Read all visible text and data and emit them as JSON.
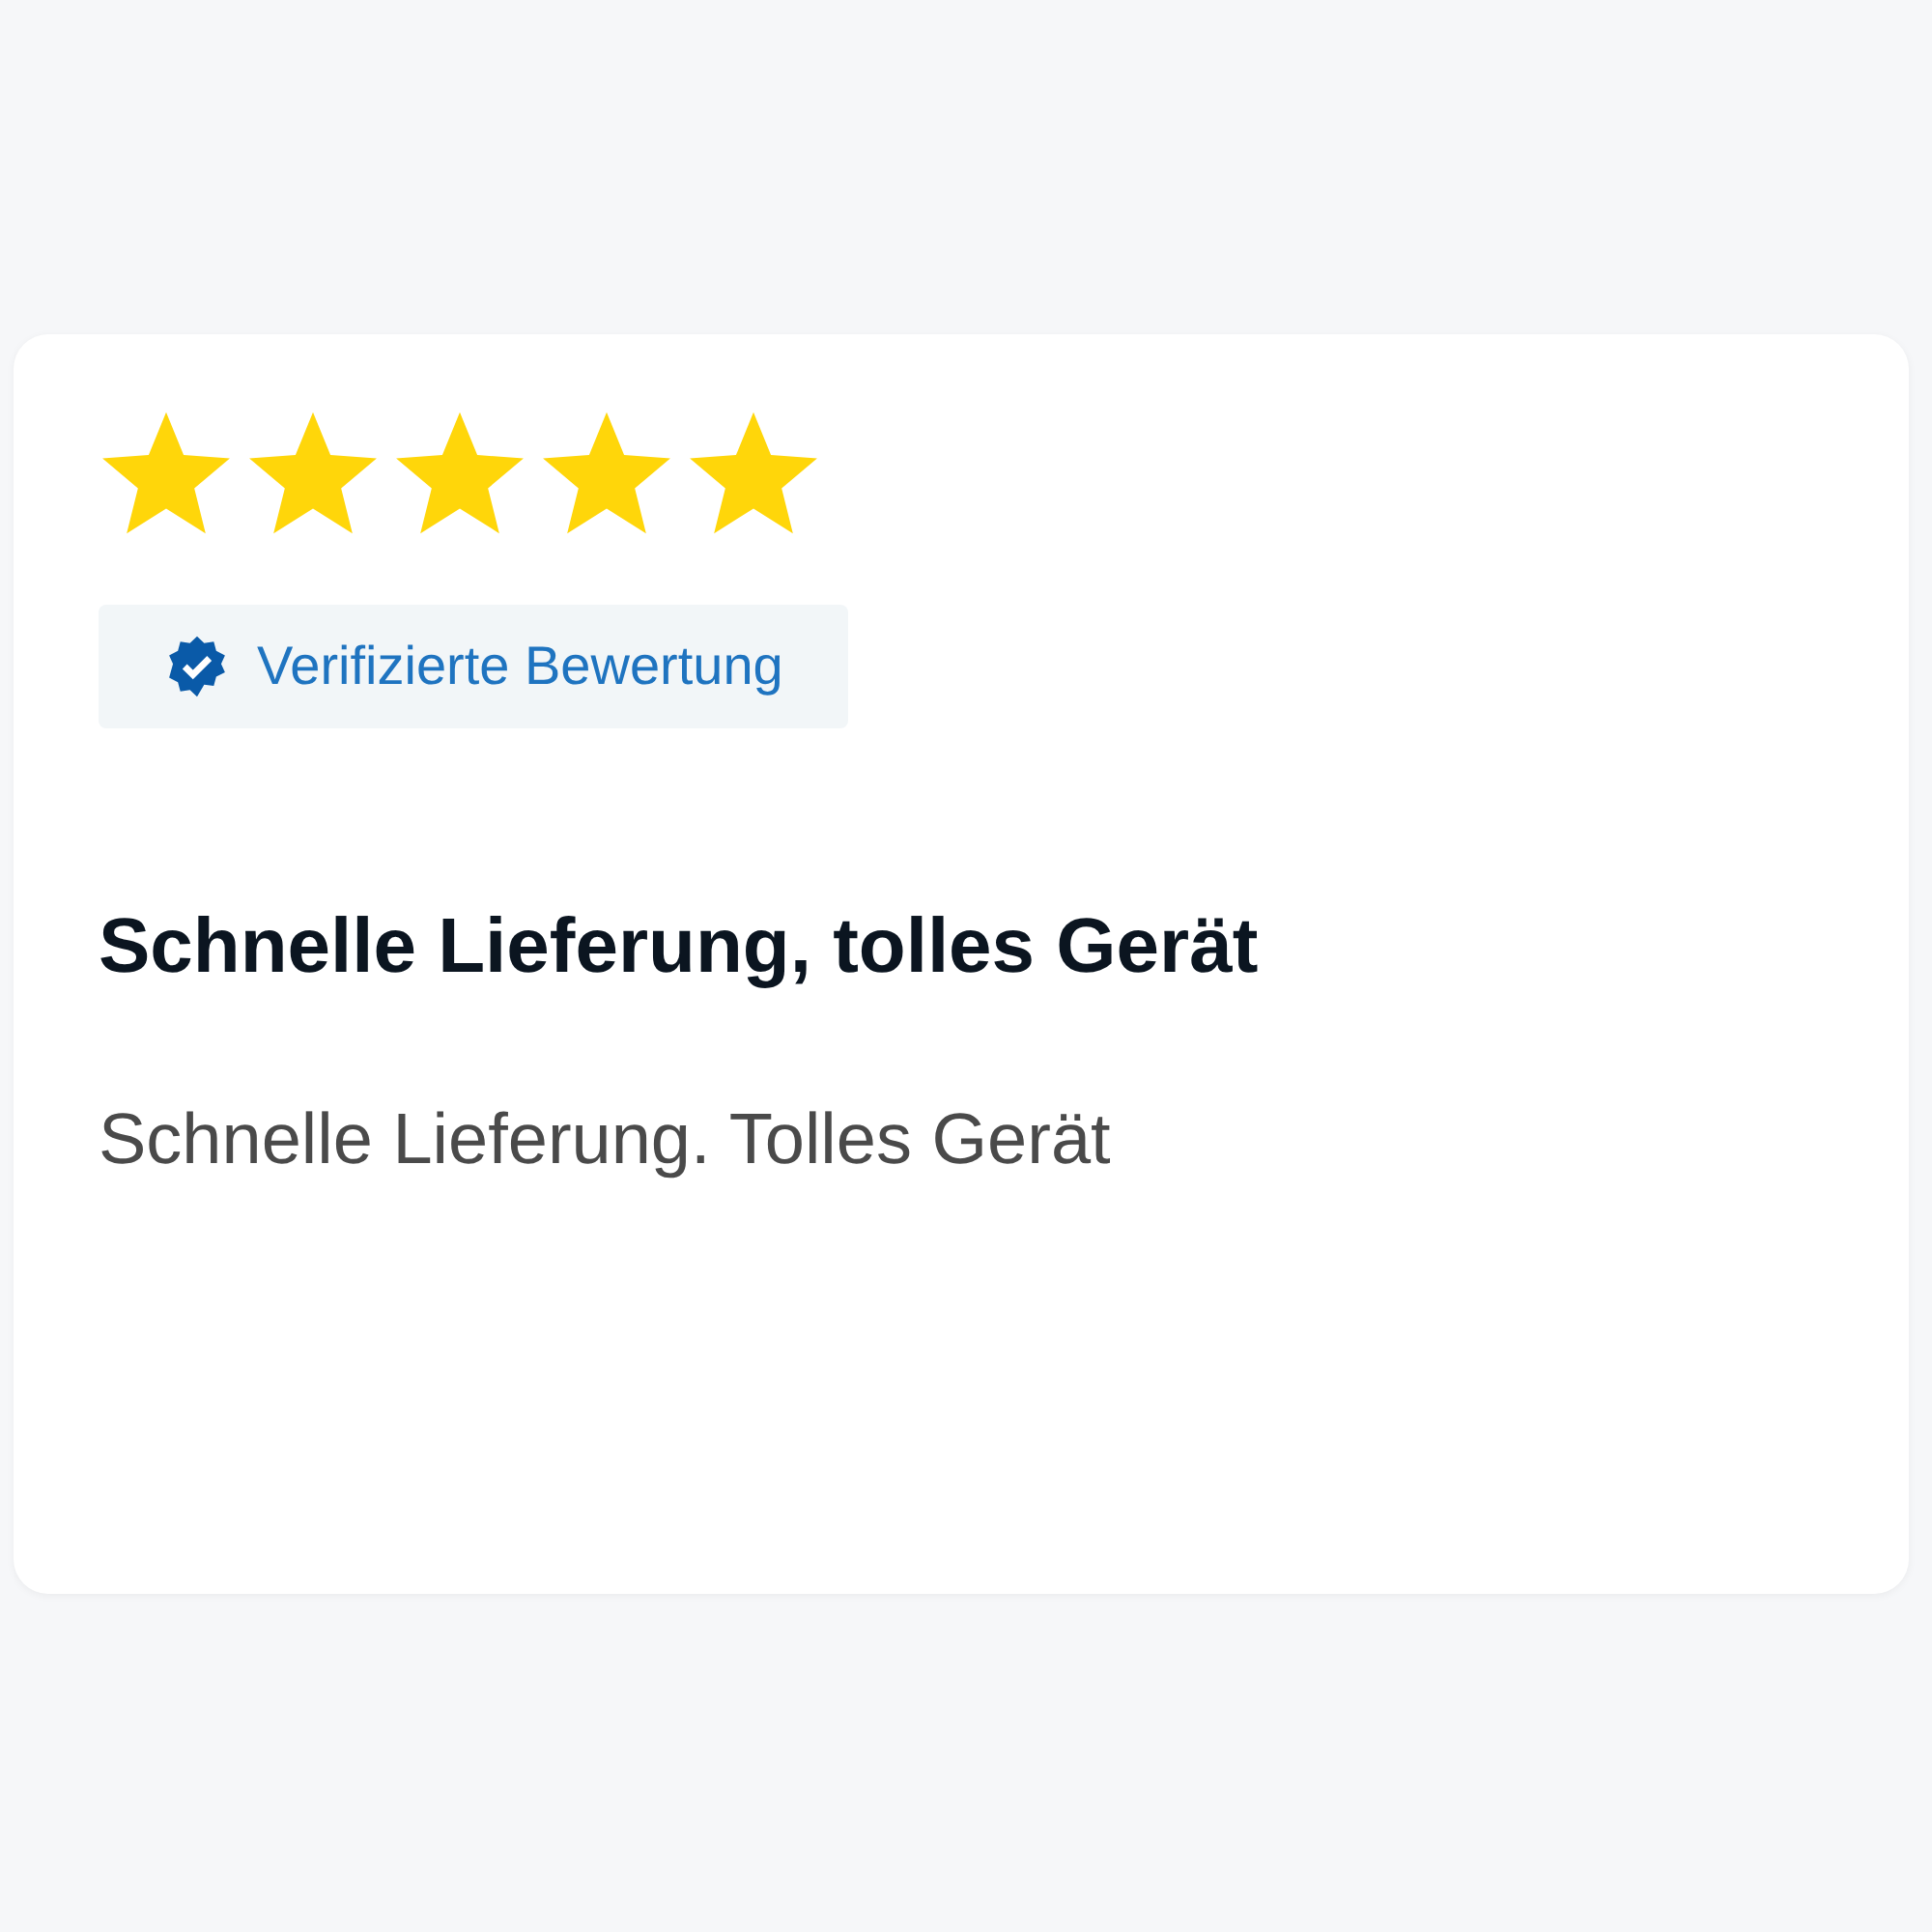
{
  "review": {
    "stars": 5,
    "badge": {
      "label": "Verifizierte Bewertung"
    },
    "title": "Schnelle Lieferung, tolles Gerät",
    "body": "Schnelle Lieferung. Tolles Gerät"
  }
}
